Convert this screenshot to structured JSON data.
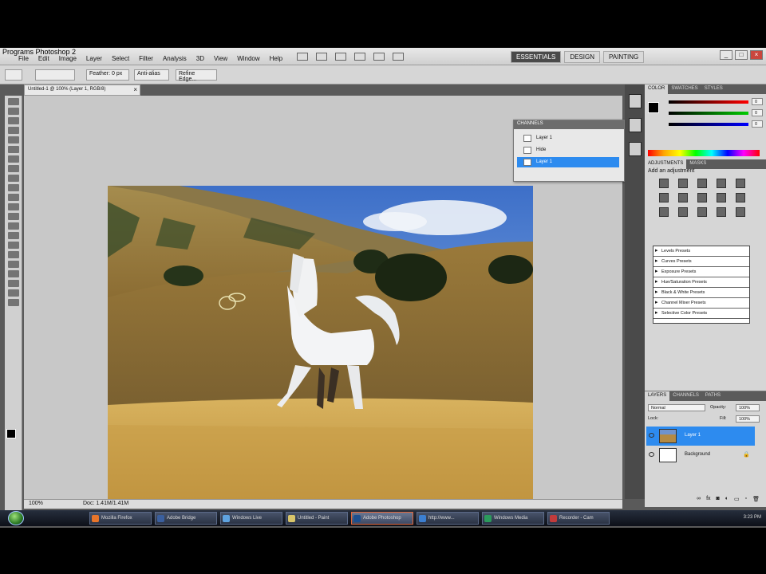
{
  "window": {
    "title": "Untitled-1 @ 100% (Layer 1, RGB/8) - Adobe Photoshop CS4"
  },
  "app_title": "Programs Photoshop 2",
  "menu": [
    "File",
    "Edit",
    "Image",
    "Layer",
    "Select",
    "Filter",
    "Analysis",
    "3D",
    "View",
    "Window",
    "Help"
  ],
  "workspace_tabs": [
    {
      "label": "ESSENTIALS",
      "active": true
    },
    {
      "label": "DESIGN",
      "active": false
    },
    {
      "label": "PAINTING",
      "active": false
    }
  ],
  "options": {
    "feather_label": "Feather:",
    "feather_value": "0 px",
    "antialias_label": "Anti-alias",
    "refine_label": "Refine Edge..."
  },
  "document_tab": {
    "label": "Untitled-1 @ 100% (Layer 1, RGB/8)"
  },
  "status": {
    "zoom": "100%",
    "doc": "Doc: 1.41M/1.41M"
  },
  "channels_panel": {
    "title": "CHANNELS",
    "rows": [
      {
        "label": "Layer 1",
        "selected": false
      },
      {
        "label": "Hide",
        "selected": false
      },
      {
        "label": "Layer 1",
        "selected": true
      }
    ]
  },
  "color_panel": {
    "tabs": [
      "COLOR",
      "SWATCHES",
      "STYLES"
    ],
    "r": "0",
    "g": "0",
    "b": "0"
  },
  "adjustments_panel": {
    "tabs": [
      "ADJUSTMENTS",
      "MASKS"
    ],
    "title": "Add an adjustment",
    "presets": [
      "Levels Presets",
      "Curves Presets",
      "Exposure Presets",
      "Hue/Saturation Presets",
      "Black & White Presets",
      "Channel Mixer Presets",
      "Selective Color Presets"
    ]
  },
  "layers_panel": {
    "tabs": [
      "LAYERS",
      "CHANNELS",
      "PATHS"
    ],
    "blend_mode": "Normal",
    "opacity_label": "Opacity:",
    "opacity_value": "100%",
    "lock_label": "Lock:",
    "fill_label": "Fill:",
    "fill_value": "100%",
    "layers": [
      {
        "name": "Layer 1",
        "selected": true
      },
      {
        "name": "Background",
        "selected": false
      }
    ]
  },
  "taskbar": {
    "items": [
      {
        "label": "Mozilla Firefox",
        "active": false
      },
      {
        "label": "Adobe Bridge",
        "active": false
      },
      {
        "label": "Windows Live",
        "active": false
      },
      {
        "label": "Untitled - Paint",
        "active": false
      },
      {
        "label": "Adobe Photoshop",
        "active": true
      },
      {
        "label": "http://www...",
        "active": false
      },
      {
        "label": "Windows Media",
        "active": false
      },
      {
        "label": "Recorder - Cam",
        "active": false
      }
    ],
    "clock": "3:23 PM"
  }
}
